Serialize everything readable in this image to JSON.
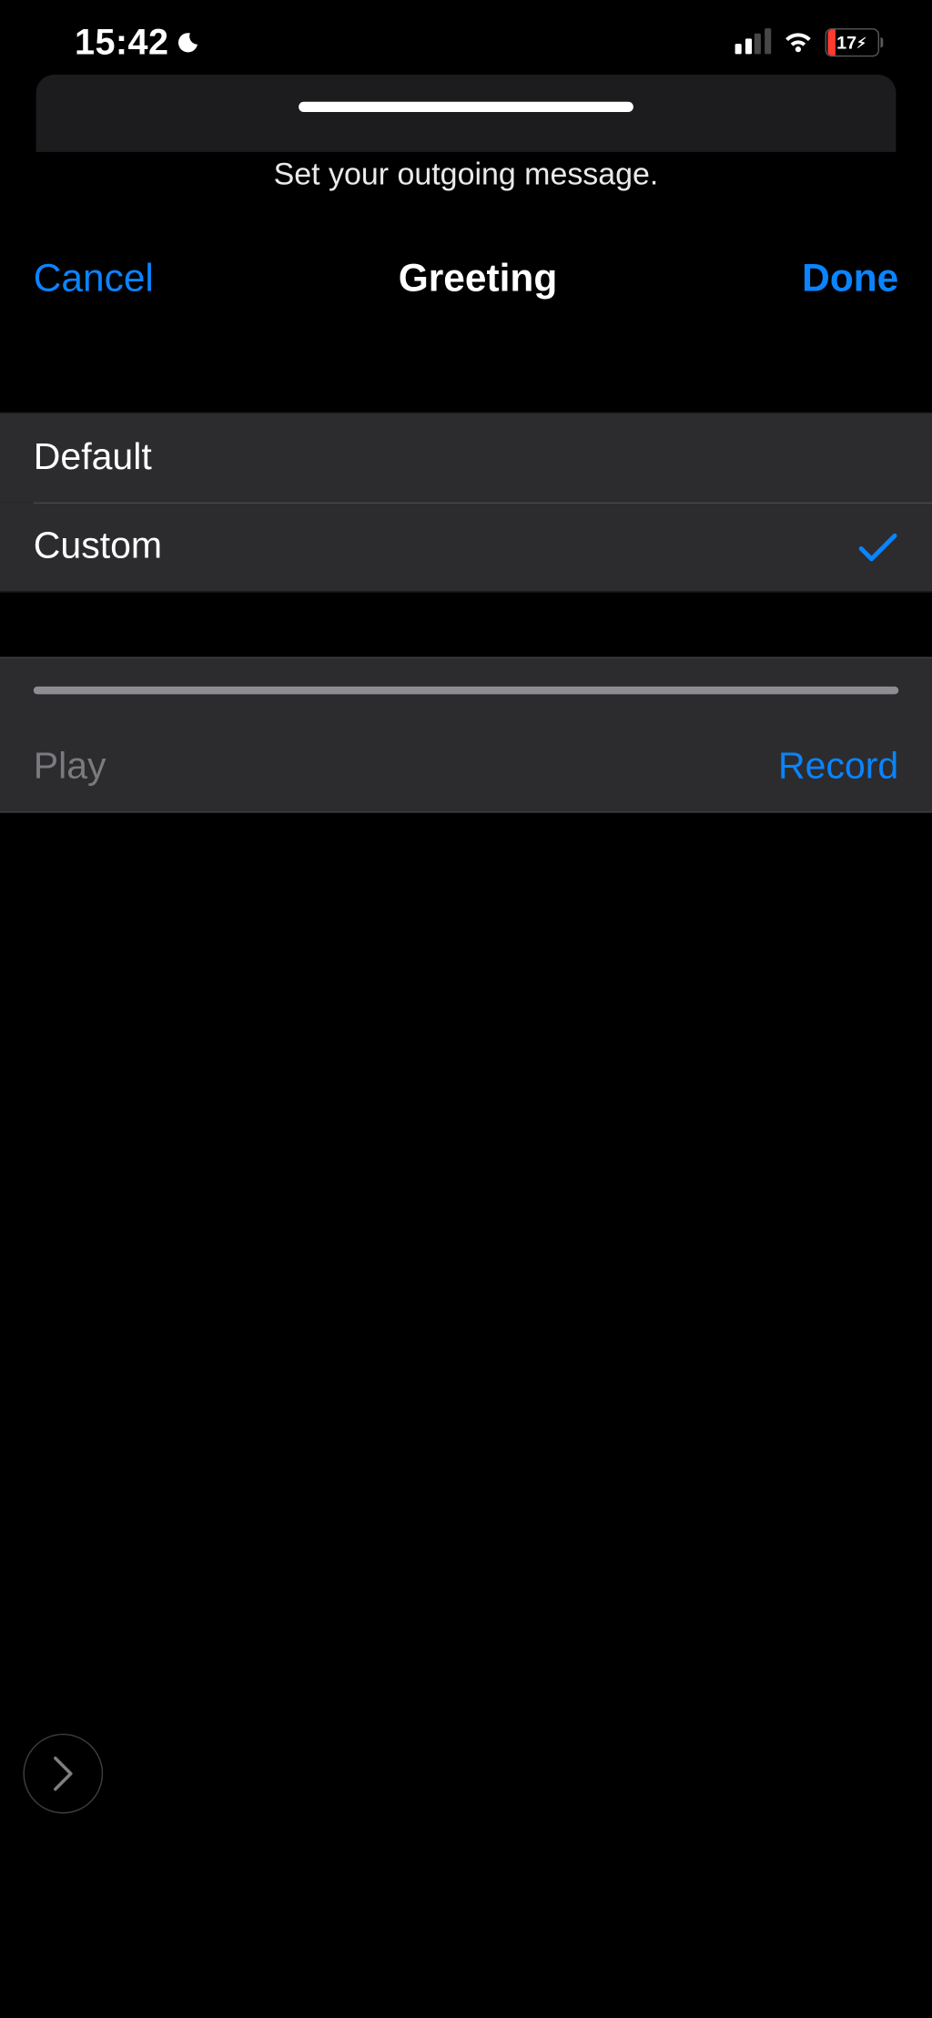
{
  "status": {
    "time": "15:42",
    "battery_pct": "17"
  },
  "sheet": {
    "subtitle": "Set your outgoing message.",
    "cancel": "Cancel",
    "title": "Greeting",
    "done": "Done"
  },
  "options": {
    "default_label": "Default",
    "custom_label": "Custom",
    "selected": "custom"
  },
  "controls": {
    "play": "Play",
    "record": "Record"
  }
}
